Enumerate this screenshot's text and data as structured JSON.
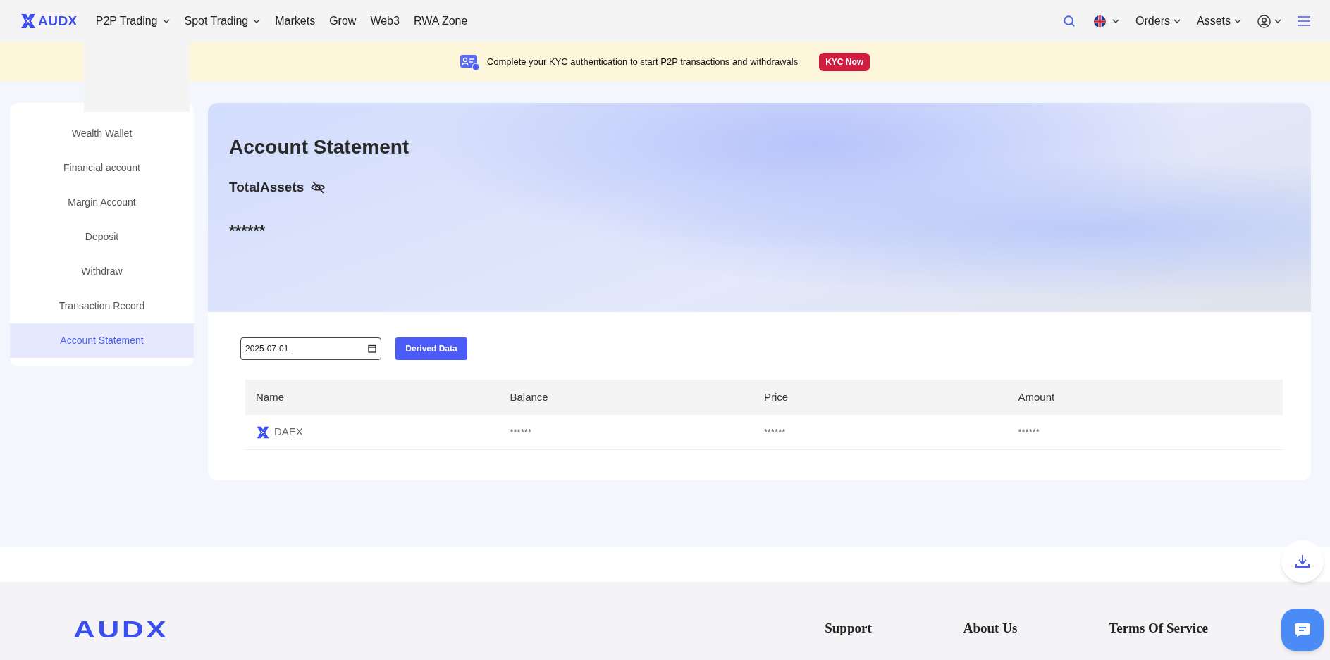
{
  "nav": {
    "logo": "AUDX",
    "items": [
      {
        "label": "P2P Trading",
        "dropdown": true
      },
      {
        "label": "Spot Trading",
        "dropdown": true
      },
      {
        "label": "Markets",
        "dropdown": false
      },
      {
        "label": "Grow",
        "dropdown": false
      },
      {
        "label": "Web3",
        "dropdown": false
      },
      {
        "label": "RWA Zone",
        "dropdown": false
      }
    ],
    "right_items": [
      {
        "label": "Orders"
      },
      {
        "label": "Assets"
      }
    ]
  },
  "banner": {
    "text": "Complete your KYC authentication to start P2P transactions and withdrawals",
    "button": "KYC Now"
  },
  "sidebar": {
    "items": [
      {
        "label": "Wealth Wallet",
        "selected": false
      },
      {
        "label": "Financial account",
        "selected": false
      },
      {
        "label": "Margin Account",
        "selected": false
      },
      {
        "label": "Deposit",
        "selected": false
      },
      {
        "label": "Withdraw",
        "selected": false
      },
      {
        "label": "Transaction Record",
        "selected": false
      },
      {
        "label": "Account Statement",
        "selected": true
      }
    ]
  },
  "hero": {
    "title": "Account Statement",
    "total_label": "TotalAssets",
    "total_value": "******"
  },
  "filters": {
    "date": "2025-07-01",
    "button": "Derived Data"
  },
  "table": {
    "columns": [
      "Name",
      "Balance",
      "Price",
      "Amount"
    ],
    "rows": [
      {
        "name": "DAEX",
        "balance": "******",
        "price": "******",
        "amount": "******"
      }
    ]
  },
  "footer": {
    "logo": "AUDX",
    "links": [
      "Support",
      "About Us",
      "Terms Of Service"
    ]
  }
}
